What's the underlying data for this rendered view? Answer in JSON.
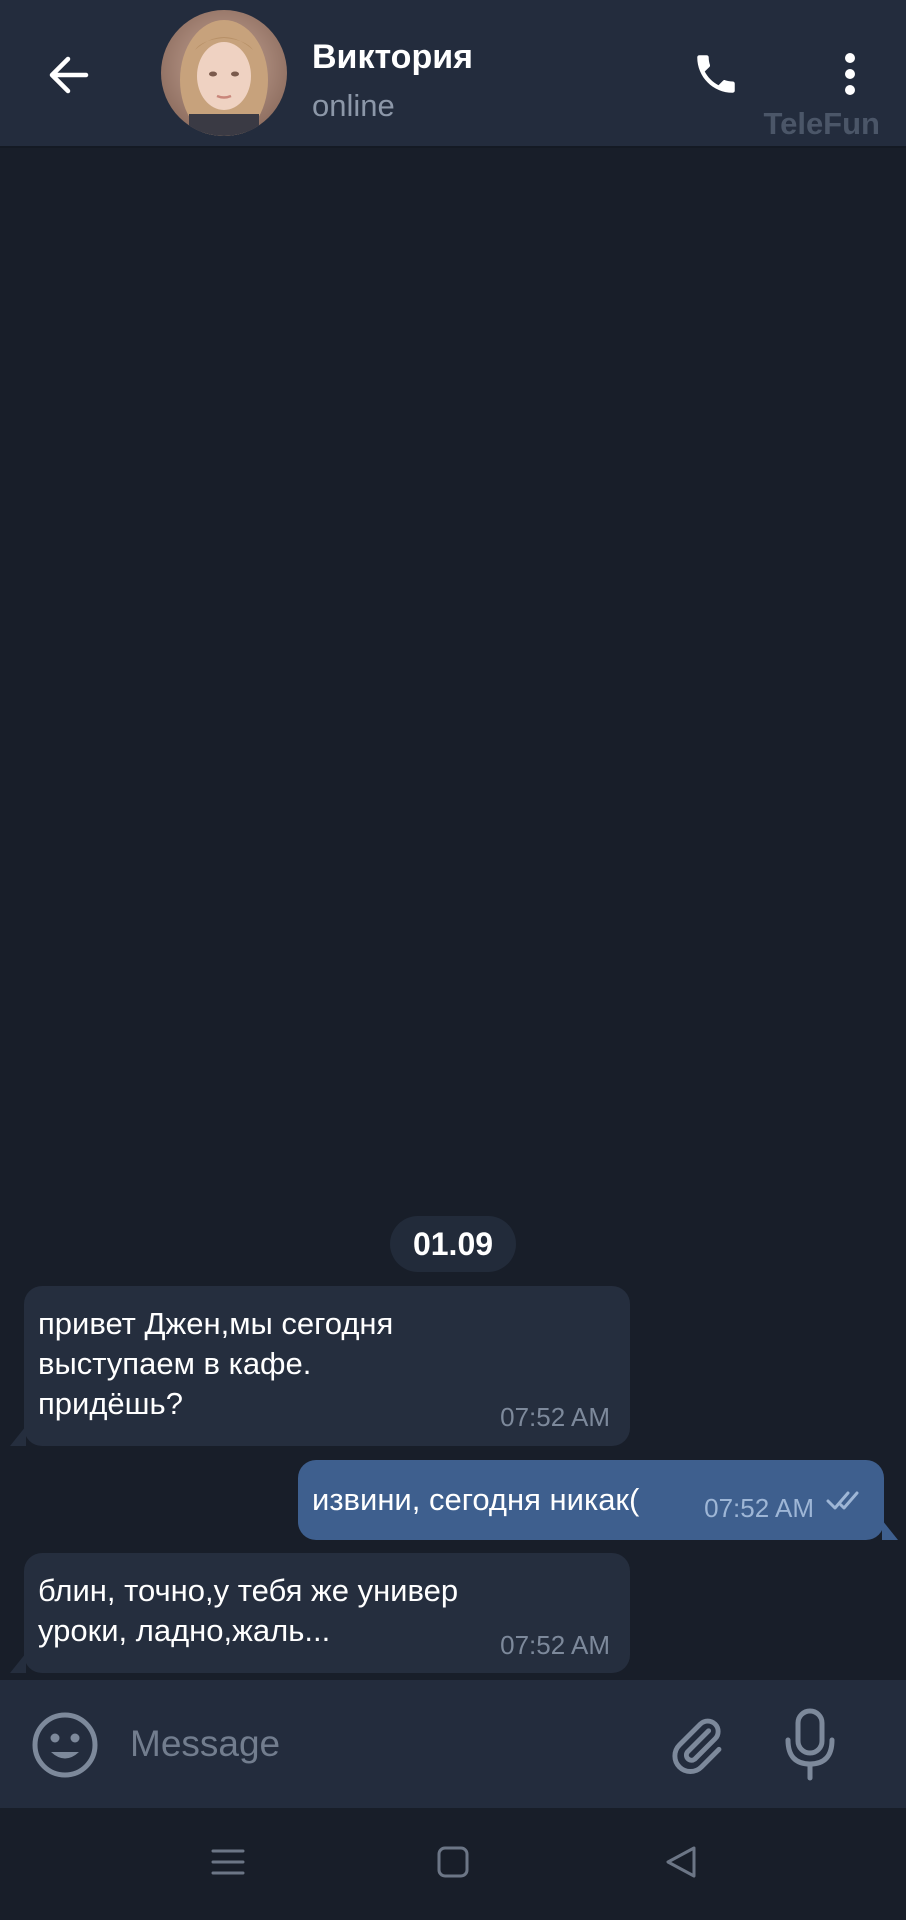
{
  "header": {
    "contact_name": "Виктория",
    "status": "online",
    "watermark": "TeleFun",
    "icons": {
      "back": "arrow-left-icon",
      "call": "phone-icon",
      "menu": "more-vertical-icon"
    }
  },
  "chat": {
    "date_label": "01.09",
    "messages": [
      {
        "direction": "incoming",
        "text": "привет Джен,мы сегодня\nвыступаем в кафе.\nпридёшь?",
        "time": "07:52 AM"
      },
      {
        "direction": "outgoing",
        "text": "извини, сегодня никак(",
        "time": "07:52 AM",
        "status": "read"
      },
      {
        "direction": "incoming",
        "text": "блин, точно,у тебя же универ\nуроки, ладно,жаль...",
        "time": "07:52 AM"
      }
    ]
  },
  "composer": {
    "placeholder": "Message",
    "icons": {
      "emoji": "smile-icon",
      "attach": "paperclip-icon",
      "mic": "microphone-icon"
    }
  },
  "system_nav": {
    "icons": [
      "menu-lines-icon",
      "home-square-icon",
      "back-triangle-icon"
    ]
  },
  "colors": {
    "background": "#181e29",
    "header": "#232c3d",
    "incoming_bubble": "#252e3e",
    "outgoing_bubble": "#3e5f8e",
    "muted_text": "#8c97a8"
  }
}
